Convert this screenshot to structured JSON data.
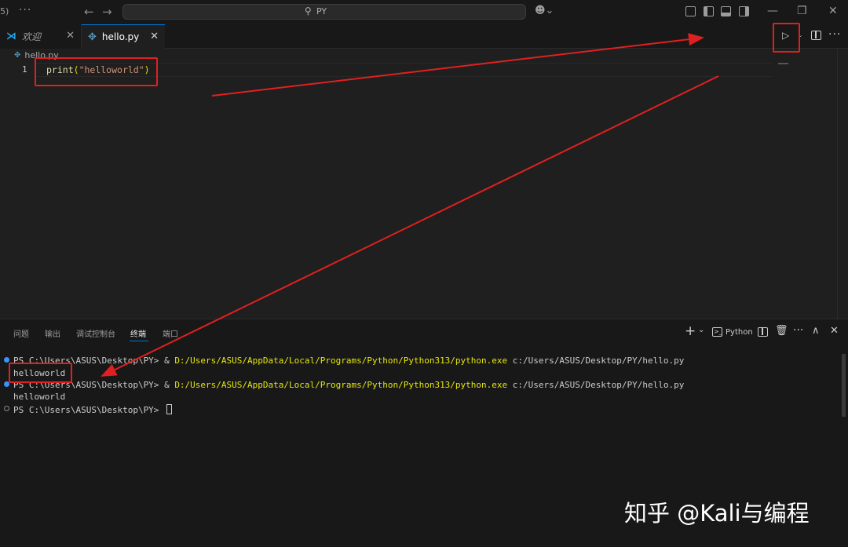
{
  "titlebar": {
    "left_glyph": "5)",
    "more": "···",
    "back_arrow": "←",
    "forward_arrow": "→",
    "search_text": "PY",
    "minimize": "—",
    "restore": "❐",
    "close": "✕"
  },
  "tabs": [
    {
      "label": "欢迎",
      "close": "✕"
    },
    {
      "label": "hello.py",
      "close": "✕"
    }
  ],
  "editor_actions": {
    "run": "▷",
    "run_dropdown": "⌄",
    "more": "···"
  },
  "breadcrumb": {
    "file": "hello.py"
  },
  "editor": {
    "line_number": "1",
    "code_fn": "print",
    "code_open": "(",
    "code_str": "\"helloworld\"",
    "code_close": ")"
  },
  "panel": {
    "tabs": [
      "问题",
      "输出",
      "调试控制台",
      "终端",
      "端口"
    ],
    "active_tab": "终端",
    "add": "+",
    "dropdown": "⌄",
    "terminal_name": "Python",
    "terminal_glyph": ">_",
    "more": "···",
    "maximize": "∧",
    "close": "✕"
  },
  "terminal": {
    "lines": [
      {
        "prompt": "PS C:\\Users\\ASUS\\Desktop\\PY> ",
        "amp": "& ",
        "exe": "D:/Users/ASUS/AppData/Local/Programs/Python/Python313/python.exe",
        "arg": " c:/Users/ASUS/Desktop/PY/hello.py"
      },
      {
        "output": "helloworld"
      },
      {
        "prompt": "PS C:\\Users\\ASUS\\Desktop\\PY> ",
        "amp": "& ",
        "exe": "D:/Users/ASUS/AppData/Local/Programs/Python/Python313/python.exe",
        "arg": " c:/Users/ASUS/Desktop/PY/hello.py"
      },
      {
        "output": "helloworld"
      },
      {
        "prompt": "PS C:\\Users\\ASUS\\Desktop\\PY> "
      }
    ]
  },
  "watermark": "知乎 @Kali与编程",
  "colors": {
    "annotation": "#e02020",
    "accent": "#0078d4",
    "python_icon": "#519aba",
    "vscode_icon": "#23a9f2"
  }
}
